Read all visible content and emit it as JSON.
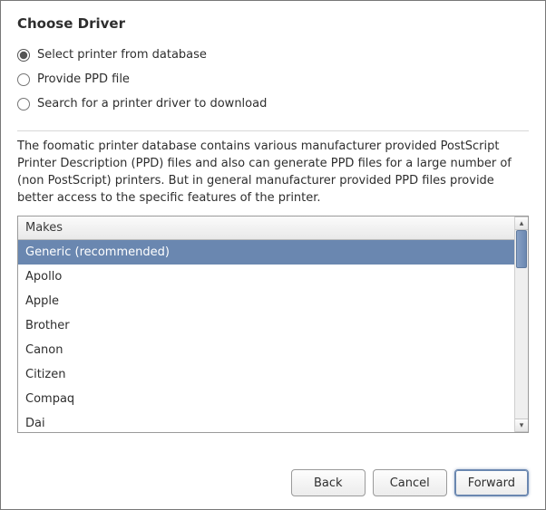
{
  "title": "Choose Driver",
  "radios": {
    "database": {
      "label": "Select printer from database",
      "checked": true
    },
    "ppd": {
      "label": "Provide PPD file",
      "checked": false
    },
    "download": {
      "label": "Search for a printer driver to download",
      "checked": false
    }
  },
  "description": "The foomatic printer database contains various manufacturer provided PostScript Printer Description (PPD) files and also can generate PPD files for a large number of (non PostScript) printers. But in general manufacturer provided PPD files provide better access to the specific features of the printer.",
  "list": {
    "header": "Makes",
    "selected_index": 0,
    "items": [
      "Generic (recommended)",
      "Apollo",
      "Apple",
      "Brother",
      "Canon",
      "Citizen",
      "Compaq",
      "Dai"
    ]
  },
  "buttons": {
    "back": "Back",
    "cancel": "Cancel",
    "forward": "Forward"
  }
}
